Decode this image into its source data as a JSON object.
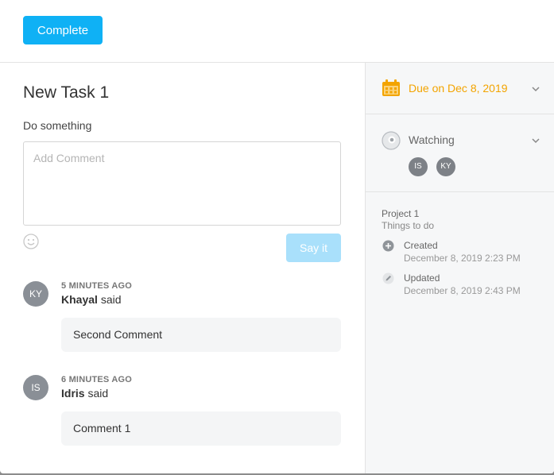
{
  "header": {
    "complete_label": "Complete"
  },
  "task": {
    "title": "New Task 1",
    "description": "Do something"
  },
  "comment_input": {
    "placeholder": "Add Comment",
    "submit_label": "Say it"
  },
  "comments": [
    {
      "time": "5 MINUTES AGO",
      "initials": "KY",
      "author": "Khayal",
      "verb": "said",
      "text": "Second Comment"
    },
    {
      "time": "6 MINUTES AGO",
      "initials": "IS",
      "author": "Idris",
      "verb": "said",
      "text": "Comment 1"
    }
  ],
  "sidebar": {
    "due": {
      "label": "Due on Dec 8, 2019",
      "icon": "calendar-icon",
      "color": "#f3a400"
    },
    "watching": {
      "label": "Watching",
      "icon": "eye-icon",
      "watchers": [
        "IS",
        "KY"
      ]
    },
    "project": "Project 1",
    "list": "Things to do",
    "created": {
      "label": "Created",
      "date": "December 8, 2019 2:23 PM",
      "icon": "plus-circle-icon"
    },
    "updated": {
      "label": "Updated",
      "date": "December 8, 2019 2:43 PM",
      "icon": "pencil-icon"
    }
  },
  "colors": {
    "accent": "#0fb1f5",
    "accent_disabled": "#a9e0fb",
    "due": "#f3a400"
  }
}
